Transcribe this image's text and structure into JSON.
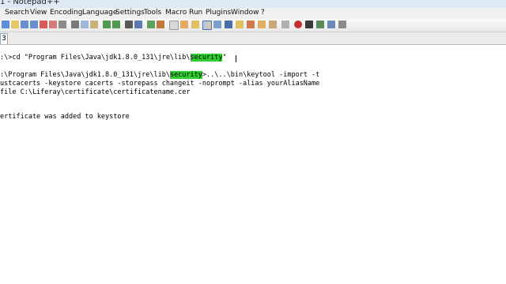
{
  "window": {
    "title": "1 - Notepad++"
  },
  "menu": [
    "Search",
    "View",
    "Encoding",
    "Language",
    "Settings",
    "Tools",
    "Macro",
    "Run",
    "Plugins",
    "Window",
    "?"
  ],
  "toolbar": {
    "icons": [
      "new-file-icon",
      "open-file-icon",
      "save-icon",
      "save-all-icon",
      "close-icon",
      "close-all-icon",
      "print-icon",
      "cut-icon",
      "copy-icon",
      "paste-icon",
      "undo-icon",
      "redo-icon",
      "find-icon",
      "replace-icon",
      "zoom-in-icon",
      "zoom-out-icon",
      "sync-vertical-icon",
      "sync-horizontal-icon",
      "word-wrap-icon",
      "show-all-chars-icon",
      "indent-guide-icon",
      "user-lang-icon",
      "doc-map-icon",
      "function-list-icon",
      "folder-workspace-icon",
      "monitoring-icon",
      "record-macro-icon",
      "stop-record-icon",
      "play-macro-icon",
      "play-multiple-icon",
      "save-macro-icon"
    ]
  },
  "tab": {
    "label": "3"
  },
  "editor": {
    "line1": {
      "pre": ":\\>cd \"Program Files\\Java\\jdk1.8.0_131\\jre\\lib\\",
      "hl": "security",
      "post": "\""
    },
    "line2": {
      "pre": ":\\Program Files\\Java\\jdk1.8.0_131\\jre\\lib\\",
      "hl": "security",
      "post": ">..\\..\\bin\\keytool -import -t"
    },
    "line3": "ustcacerts -keystore cacerts -storepass changeit -noprompt -alias yourAliasName",
    "line4": "file C:\\Liferay\\certificate\\certificatename.cer",
    "line5": "ertificate was added to keystore"
  },
  "colors": {
    "highlight": "#32cd32",
    "menubar": "#f0f0f0",
    "titlebar": "#dfe9f5"
  }
}
